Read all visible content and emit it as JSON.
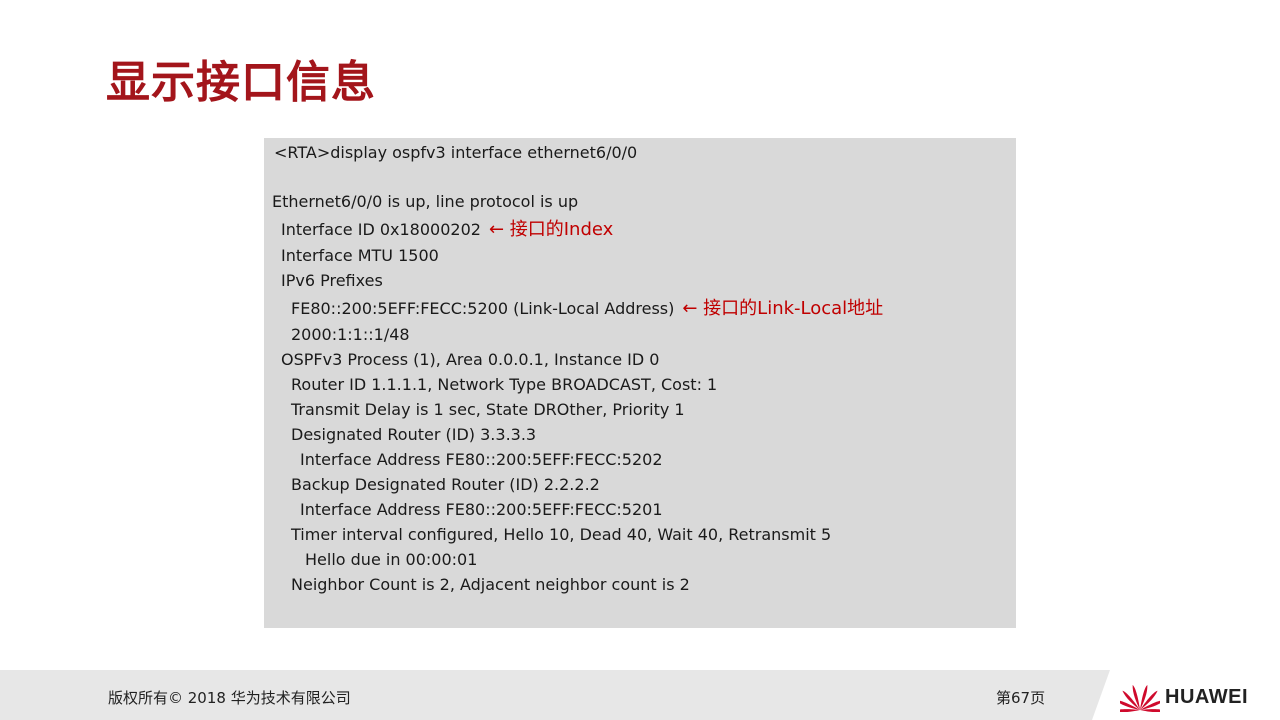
{
  "title": "显示接口信息",
  "console": {
    "lines": [
      {
        "text": "<RTA>display ospfv3 interface ethernet6/0/0"
      },
      {
        "text": "Ethernet6/0/0 is up, line protocol is up"
      },
      {
        "text": "Interface ID 0x18000202",
        "note": "← 接口的Index"
      },
      {
        "text": "Interface MTU 1500"
      },
      {
        "text": "IPv6 Prefixes"
      },
      {
        "text": "FE80::200:5EFF:FECC:5200 (Link-Local Address)",
        "note": "← 接口的Link-Local地址"
      },
      {
        "text": "2000:1:1::1/48"
      },
      {
        "text": "OSPFv3 Process (1), Area 0.0.0.1, Instance ID 0"
      },
      {
        "text": "Router ID 1.1.1.1, Network Type BROADCAST, Cost: 1"
      },
      {
        "text": "Transmit Delay is 1 sec, State DROther, Priority 1"
      },
      {
        "text": "Designated Router (ID) 3.3.3.3"
      },
      {
        "text": "Interface Address FE80::200:5EFF:FECC:5202"
      },
      {
        "text": "Backup Designated Router (ID) 2.2.2.2"
      },
      {
        "text": "Interface Address FE80::200:5EFF:FECC:5201"
      },
      {
        "text": "Timer interval configured, Hello 10, Dead 40, Wait 40, Retransmit 5"
      },
      {
        "text": "Hello due in 00:00:01"
      },
      {
        "text": "Neighbor Count is 2, Adjacent neighbor count is 2"
      }
    ]
  },
  "footer": {
    "copyright": "版权所有© 2018 华为技术有限公司",
    "page": "第67页",
    "brand": "HUAWEI"
  },
  "colors": {
    "accent": "#a3151b",
    "note": "#c00000",
    "console_bg": "#d9d9d9",
    "footer_bg": "#e7e7e7"
  },
  "icons": {
    "logo": "huawei-logo-icon"
  }
}
